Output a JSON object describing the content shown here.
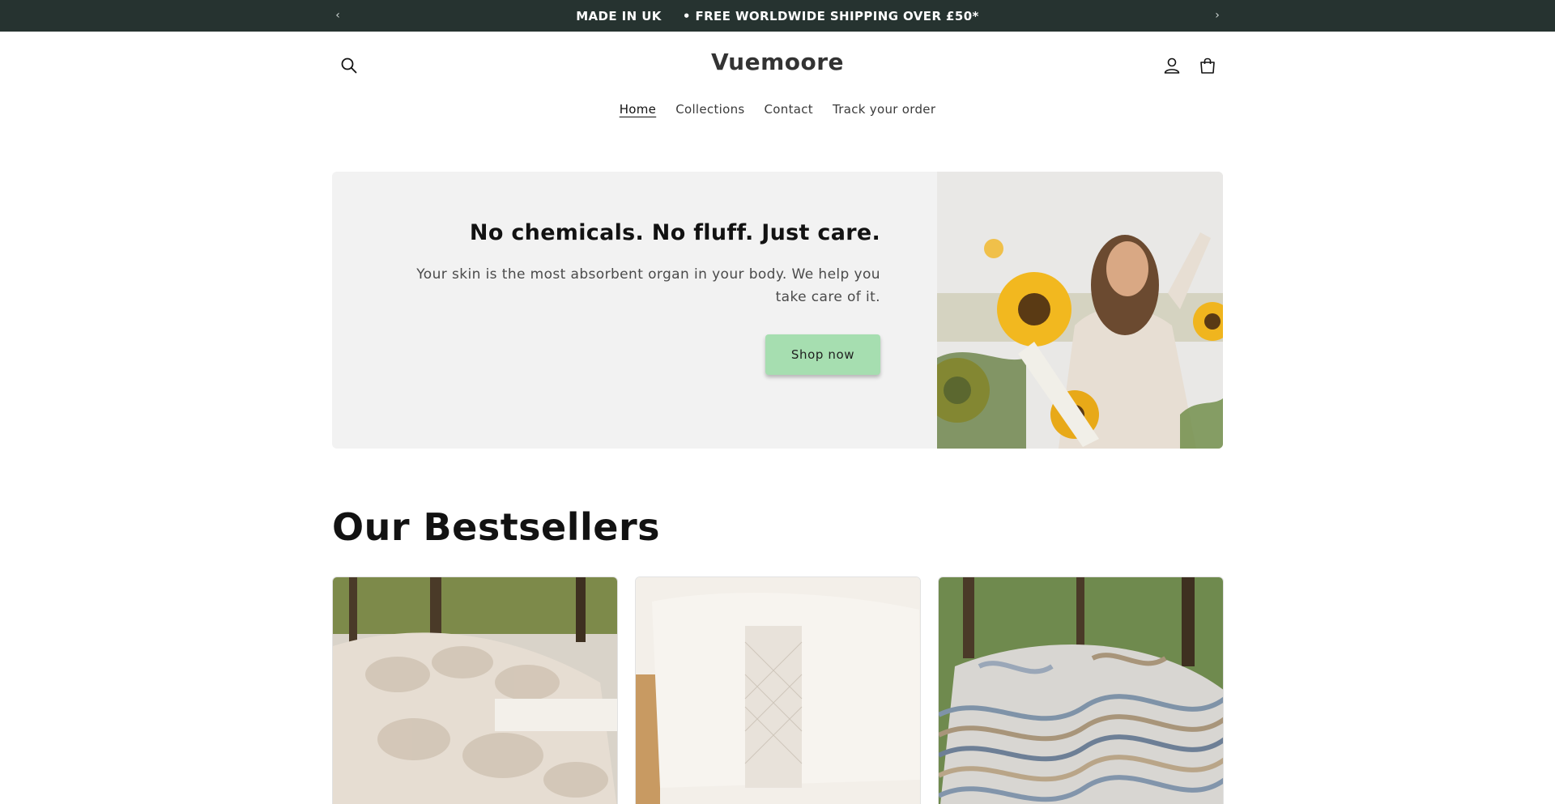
{
  "announcement": {
    "items": [
      "MADE IN UK",
      "• FREE WORLDWIDE SHIPPING OVER £50*"
    ],
    "prev_icon": "chevron-left-icon",
    "next_icon": "chevron-right-icon"
  },
  "header": {
    "logo": "Vuemoore",
    "icons": [
      "search-icon",
      "account-icon",
      "cart-icon"
    ],
    "nav": [
      {
        "label": "Home",
        "active": true
      },
      {
        "label": "Collections",
        "active": false
      },
      {
        "label": "Contact",
        "active": false
      },
      {
        "label": "Track your order",
        "active": false
      }
    ]
  },
  "hero": {
    "title": "No chemicals. No fluff. Just care.",
    "subtitle": "Your skin is the most absorbent organ in your body. We help you take care of it.",
    "button_label": "Shop now",
    "button_color": "#a6deb0"
  },
  "bestsellers": {
    "title": "Our Bestsellers"
  },
  "colors": {
    "announcement_bg": "#263330",
    "hero_bg": "#f2f2f2",
    "text": "#121212"
  }
}
